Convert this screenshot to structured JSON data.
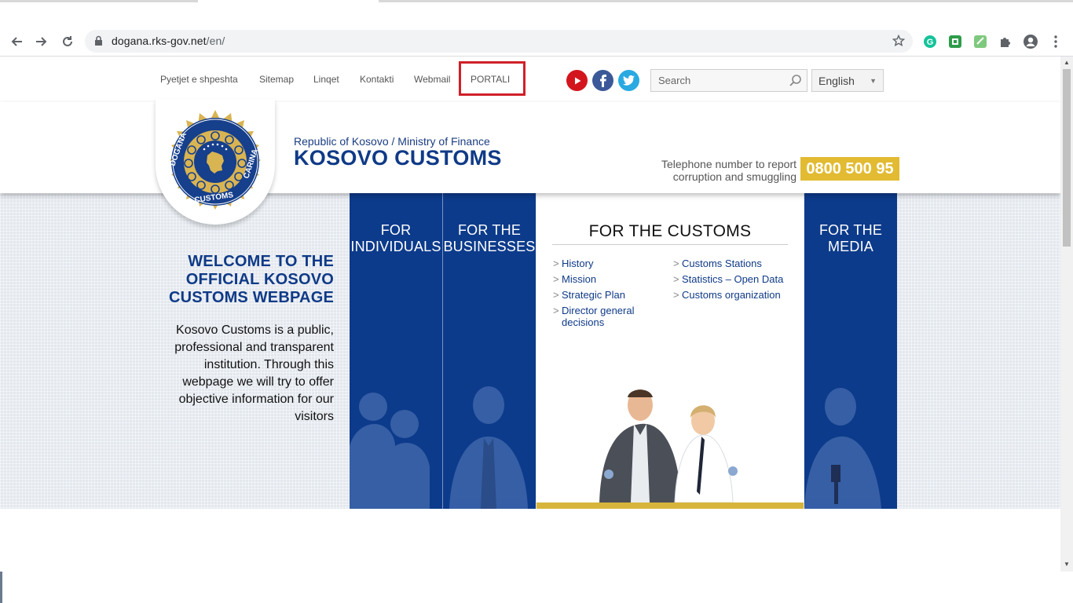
{
  "browser": {
    "url_host": "dogana.rks-gov.net",
    "url_path": "/en/"
  },
  "topnav": {
    "links": [
      "Pyetjet e shpeshta",
      "Sitemap",
      "Linqet",
      "Kontakti",
      "Webmail"
    ],
    "portali": "PORTALI",
    "search_placeholder": "Search",
    "language": "English",
    "social": [
      "youtube-icon",
      "facebook-icon",
      "twitter-icon"
    ]
  },
  "header": {
    "ministry": "Republic of Kosovo / Ministry of Finance",
    "brand": "KOSOVO CUSTOMS",
    "phone_label_1": "Telephone number to report",
    "phone_label_2": "corruption and smuggling",
    "phone_number": "0800 500 95",
    "emblem_text": "DOGANA · CUSTOMS · CARINA"
  },
  "welcome": {
    "title_1": "WELCOME TO THE",
    "title_2": "OFFICIAL KOSOVO",
    "title_3": "CUSTOMS WEBPAGE",
    "text": "Kosovo Customs is a public, professional and transparent institution. Through this webpage we will try to offer objective information for our visitors"
  },
  "panels": {
    "individuals": [
      "FOR",
      "INDIVIDUALS"
    ],
    "businesses": [
      "FOR THE",
      "BUSINESSES"
    ],
    "media": [
      "FOR THE",
      "MEDIA"
    ],
    "customs": {
      "title": "FOR THE CUSTOMS",
      "left_links": [
        "History",
        "Mission",
        "Strategic Plan",
        "Director general",
        "decisions"
      ],
      "right_links": [
        "Customs Stations",
        "Statistics – Open Data",
        "Customs organization"
      ]
    }
  },
  "colors": {
    "brand_blue": "#0f3a87",
    "panel_blue": "#0d3b8b",
    "gold": "#e2bb32",
    "highlight_red": "#d0202a"
  }
}
